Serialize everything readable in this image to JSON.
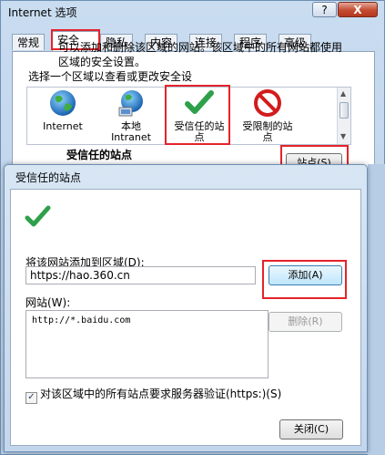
{
  "window": {
    "title": "Internet 选项",
    "help_btn": "?",
    "close_btn": "X"
  },
  "tabs": [
    {
      "label": "常规"
    },
    {
      "label": "安全"
    },
    {
      "label": "隐私"
    },
    {
      "label": "内容"
    },
    {
      "label": "连接"
    },
    {
      "label": "程序"
    },
    {
      "label": "高级"
    }
  ],
  "security": {
    "zone_prompt": "选择一个区域以查看或更改安全设",
    "zones": [
      {
        "label": "Internet",
        "icon": "globe-icon"
      },
      {
        "label": "本地\nIntranet",
        "icon": "intranet-globe-icon"
      },
      {
        "label": "受信任的站\n点",
        "icon": "green-checkmark-icon"
      },
      {
        "label": "受限制的站\n点",
        "icon": "no-entry-icon"
      }
    ],
    "selected_zone_title": "受信任的站点",
    "sites_button": "站点(S)"
  },
  "dialog": {
    "title": "受信任的站点",
    "description": "可以添加和删除该区域的网站。该区域中的所有网站都使用区域的安全设置。",
    "add_label": "将该网站添加到区域(D):",
    "url_value": "https://hao.360.cn",
    "add_button": "添加(A)",
    "websites_label": "网站(W):",
    "websites": [
      "http://*.baidu.com"
    ],
    "remove_button": "删除(R)",
    "https_checkbox_label": "对该区域中的所有站点要求服务器验证(https:)(S)",
    "https_checked": true,
    "close_button": "关闭(C)"
  },
  "colors": {
    "highlight_red": "#e5232b",
    "window_blue": "#c9dcf0"
  }
}
